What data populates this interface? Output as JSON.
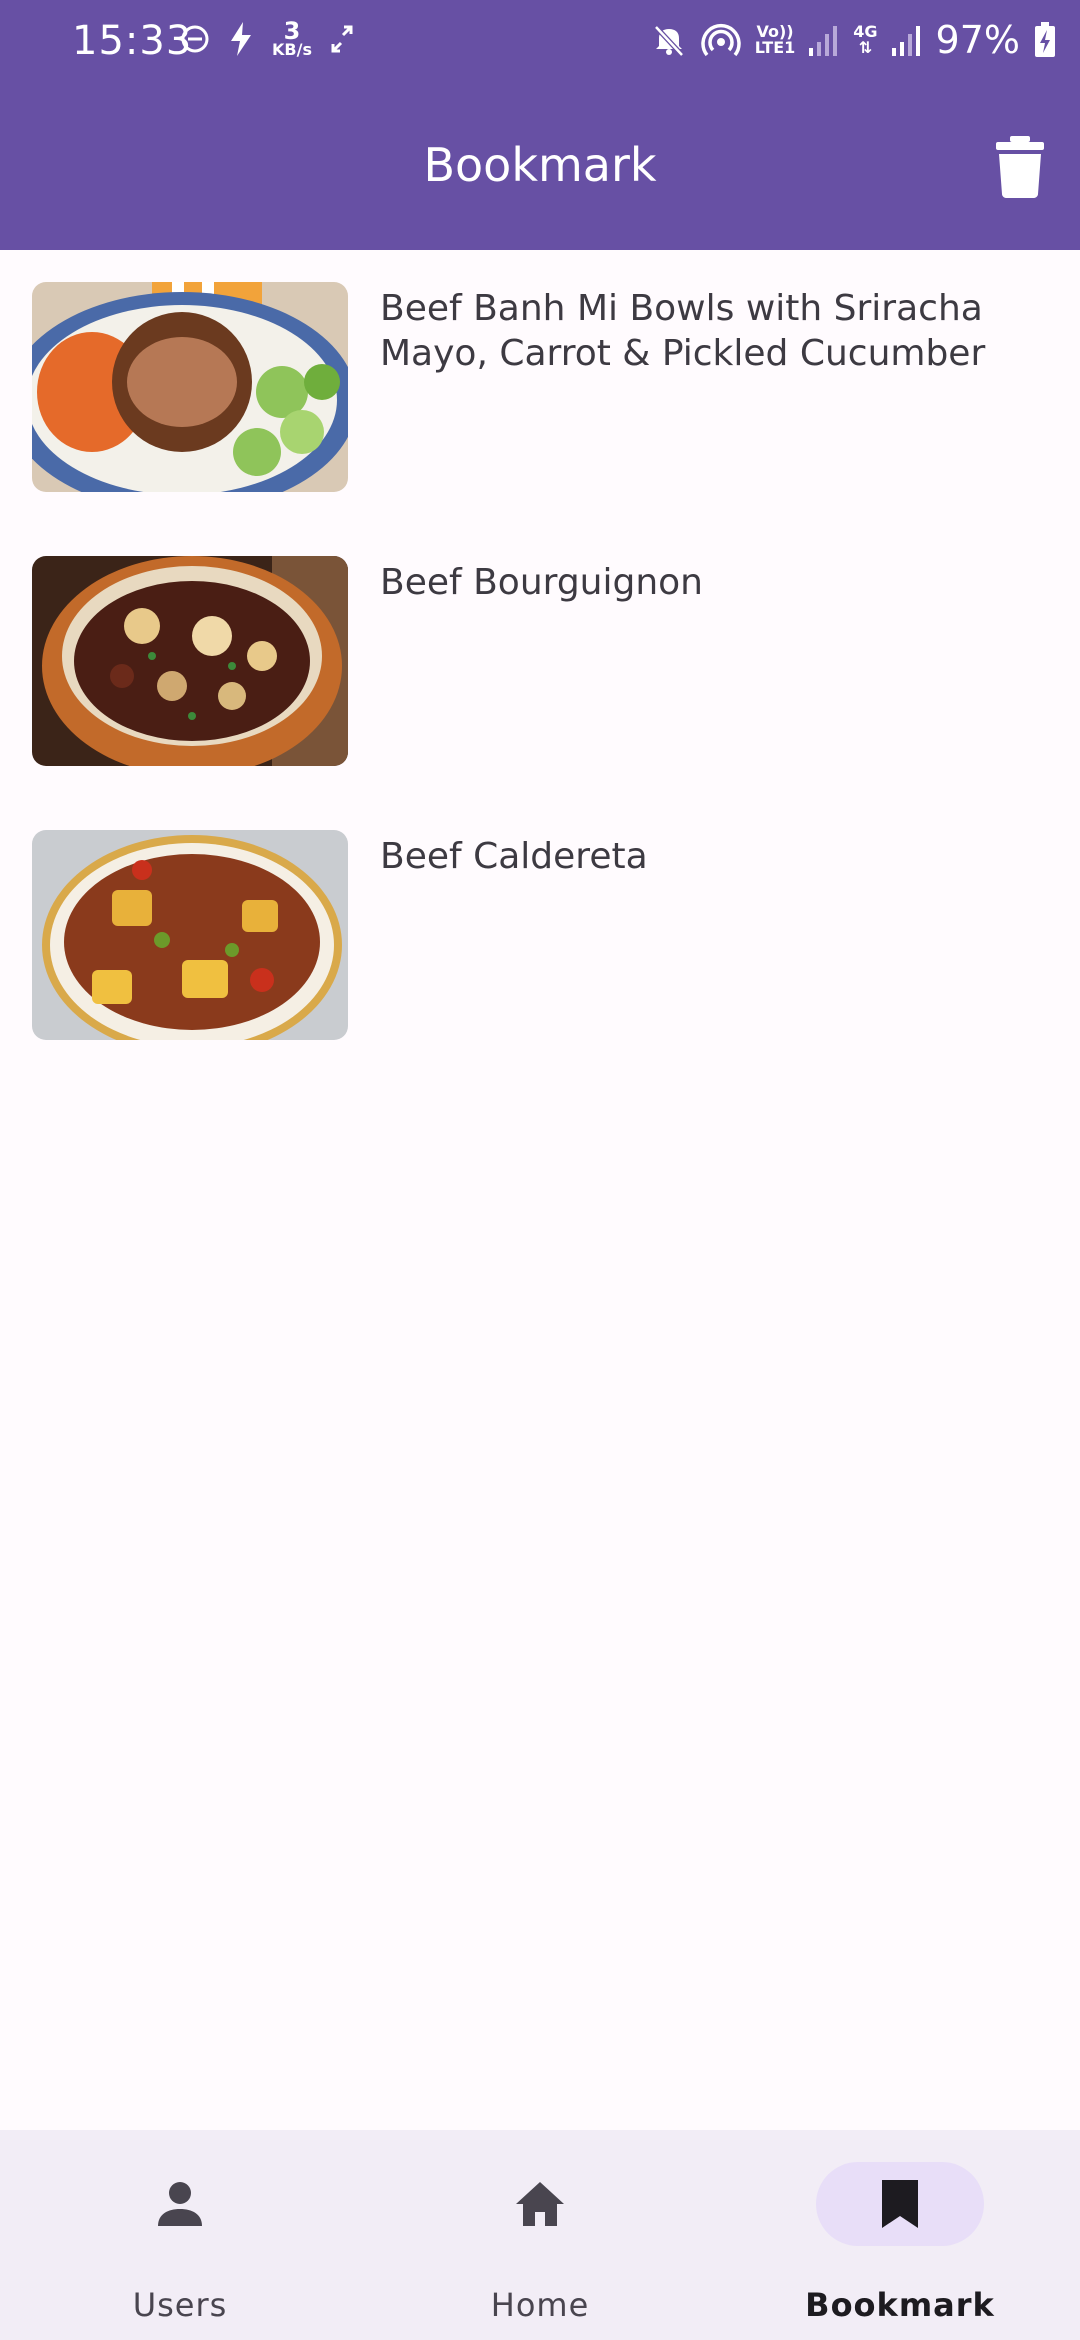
{
  "status_bar": {
    "time": "15:33",
    "speed_value": "3",
    "speed_unit": "KB/s",
    "network_label_top": "Vo))",
    "network_label_bottom": "LTE1",
    "network_type": "4G",
    "battery": "97%"
  },
  "app_bar": {
    "title": "Bookmark",
    "action_icon": "trash-icon"
  },
  "bookmarks": [
    {
      "title": "Beef Banh Mi Bowls with Sriracha Mayo, Carrot & Pickled Cucumber",
      "image": "beef-banh-mi-bowl"
    },
    {
      "title": "Beef Bourguignon",
      "image": "beef-bourguignon"
    },
    {
      "title": "Beef Caldereta",
      "image": "beef-caldereta"
    }
  ],
  "bottom_nav": {
    "items": [
      {
        "label": "Users",
        "icon": "person-icon",
        "active": false
      },
      {
        "label": "Home",
        "icon": "home-icon",
        "active": false
      },
      {
        "label": "Bookmark",
        "icon": "bookmark-icon",
        "active": true
      }
    ]
  },
  "colors": {
    "primary": "#6750a4",
    "background": "#fffbfe",
    "nav_background": "#f2edf6",
    "active_indicator": "#e8def8"
  }
}
